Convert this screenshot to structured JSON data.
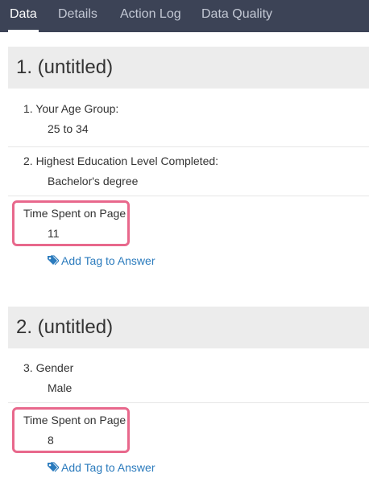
{
  "tabs": [
    {
      "label": "Data",
      "active": true
    },
    {
      "label": "Details",
      "active": false
    },
    {
      "label": "Action Log",
      "active": false
    },
    {
      "label": "Data Quality",
      "active": false
    }
  ],
  "pages": [
    {
      "title": "1. (untitled)",
      "questions": [
        {
          "label": "1. Your Age Group:",
          "value": "25 to 34"
        },
        {
          "label": "2. Highest Education Level Completed:",
          "value": "Bachelor's degree"
        }
      ],
      "time_spent": {
        "label": "Time Spent on Page",
        "value": "11"
      },
      "add_tag_label": "Add Tag to Answer"
    },
    {
      "title": "2. (untitled)",
      "questions": [
        {
          "label": "3. Gender",
          "value": "Male"
        }
      ],
      "time_spent": {
        "label": "Time Spent on Page",
        "value": "8"
      },
      "add_tag_label": "Add Tag to Answer"
    }
  ],
  "colors": {
    "tabbar_bg": "#3c4356",
    "header_bg": "#ececec",
    "highlight": "#e8688c",
    "link": "#2b7bbd"
  },
  "icons": {
    "add_tag": "tag-icon"
  }
}
